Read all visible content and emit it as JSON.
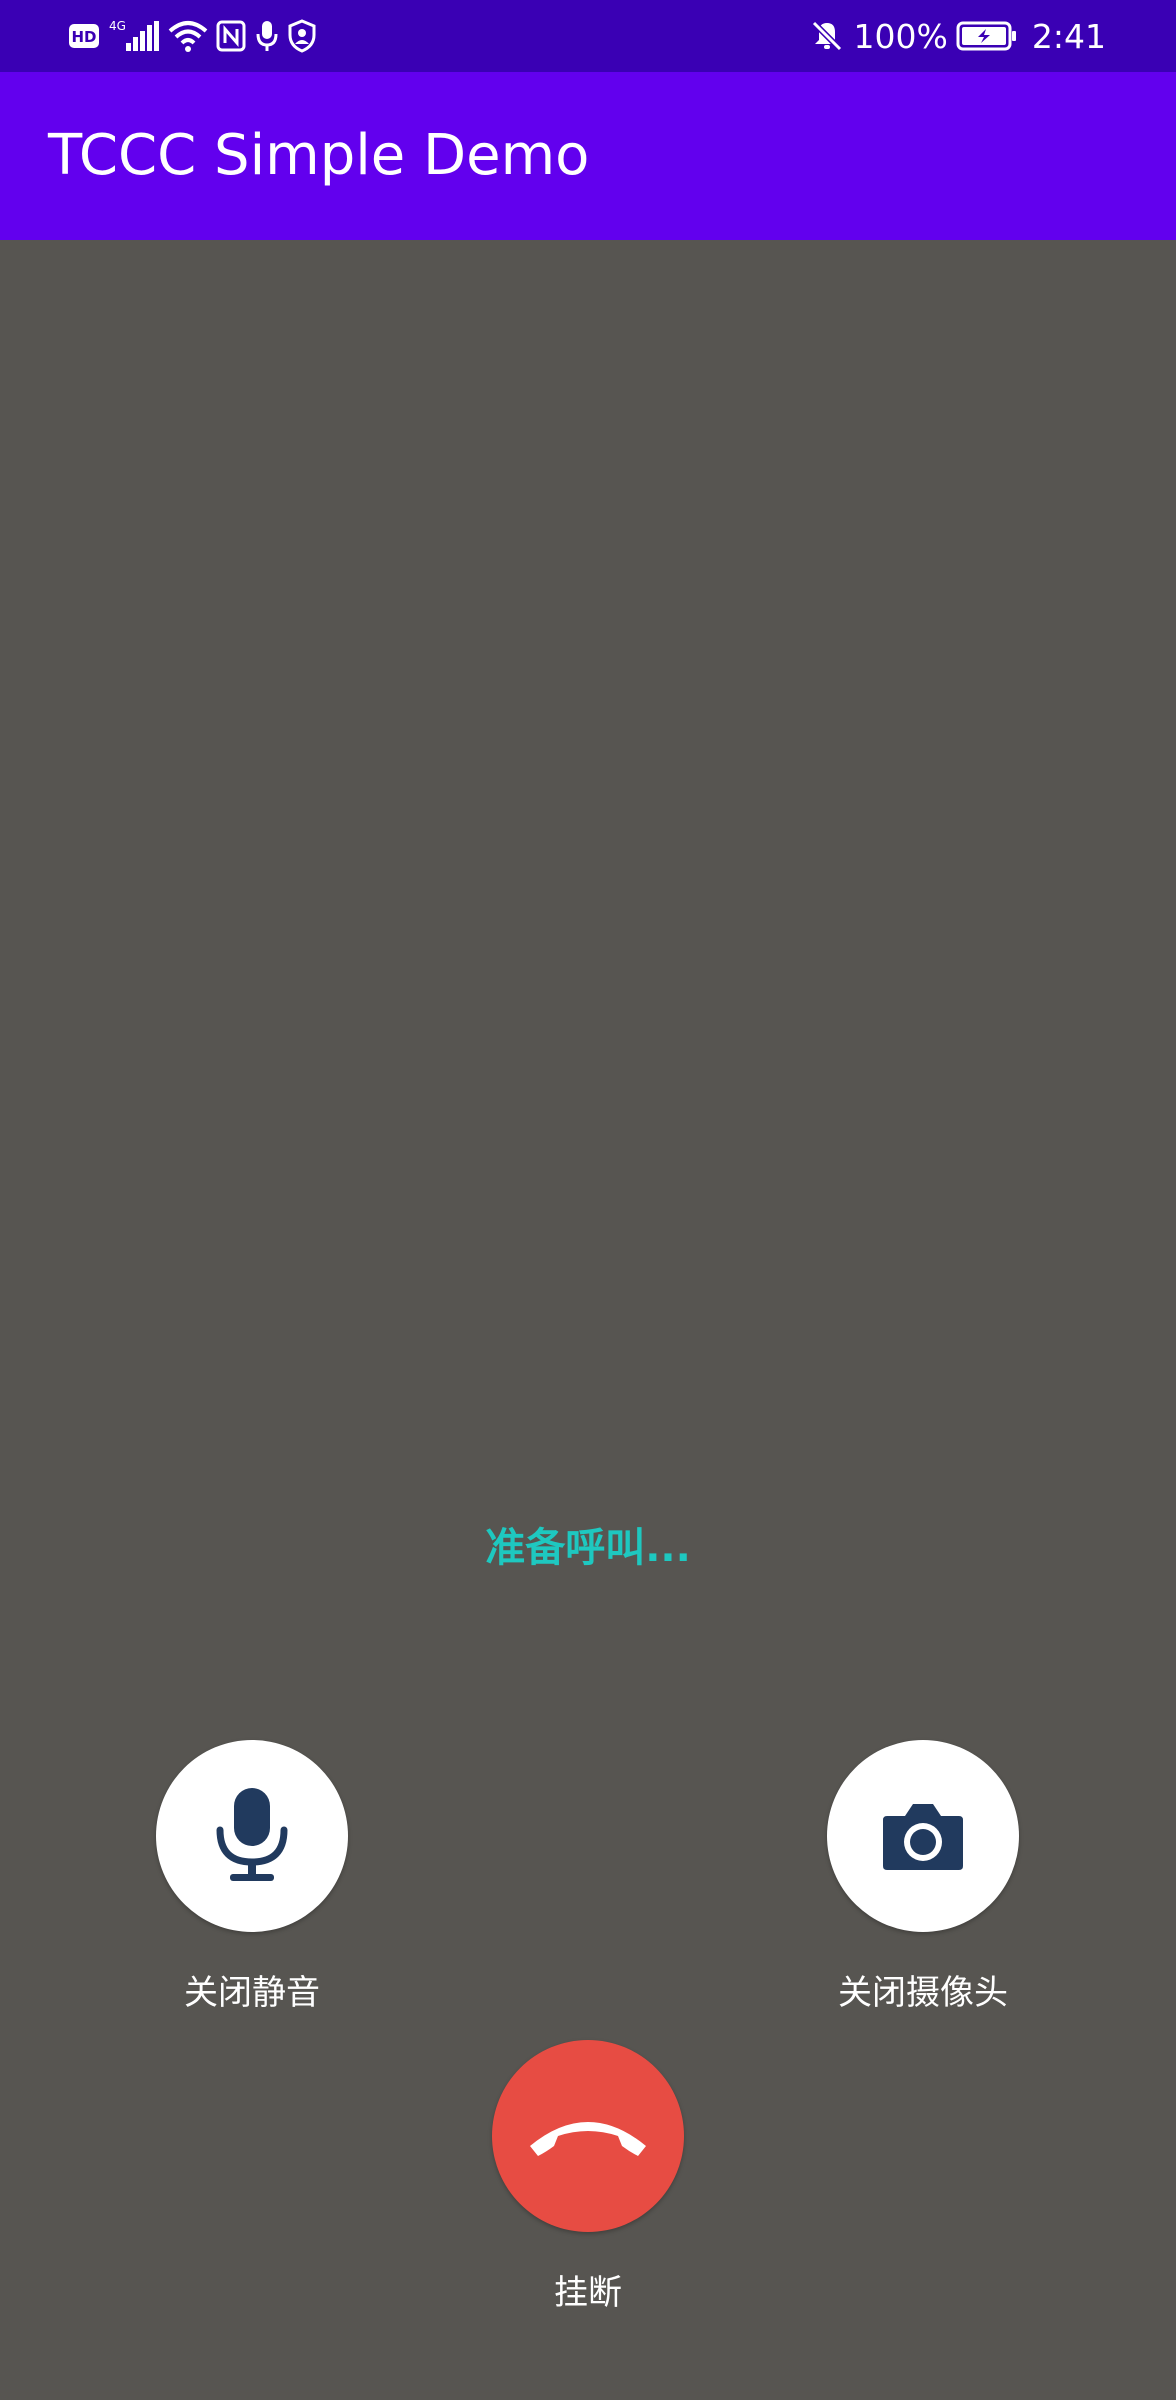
{
  "status_bar": {
    "hd": "HD",
    "network": "4G",
    "battery_percent": "100%",
    "time": "2:41"
  },
  "app_bar": {
    "title": "TCCC Simple Demo"
  },
  "call": {
    "status": "准备呼叫..."
  },
  "controls": {
    "mute": {
      "label": "关闭静音",
      "icon": "microphone-icon"
    },
    "camera": {
      "label": "关闭摄像头",
      "icon": "camera-icon"
    },
    "hangup": {
      "label": "挂断",
      "icon": "hang-up-icon"
    }
  },
  "colors": {
    "status_bar": "#3a00b4",
    "app_bar": "#6200ee",
    "background": "#575551",
    "status_text": "#1ec8c0",
    "hangup": "#e74c43",
    "icon": "#213a5e"
  }
}
